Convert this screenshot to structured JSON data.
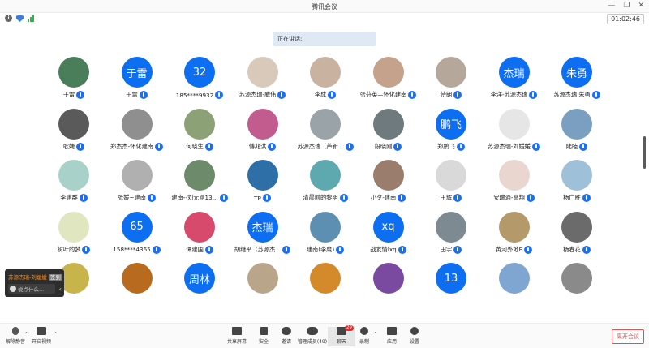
{
  "window": {
    "title": "腾讯会议"
  },
  "status": {
    "timer": "01:02:46"
  },
  "banner": {
    "speaking": "正在讲话:"
  },
  "participants": [
    {
      "name": "于雷",
      "avatar_text": "",
      "color": "#4a7e5a"
    },
    {
      "name": "于雷",
      "avatar_text": "于雷",
      "color": "#0e6ef2"
    },
    {
      "name": "185****9932",
      "avatar_text": "32",
      "color": "#0e6ef2"
    },
    {
      "name": "苏源杰瑞-威伟",
      "avatar_text": "",
      "color": "#d9c9bb"
    },
    {
      "name": "李成",
      "avatar_text": "",
      "color": "#c9b3a0"
    },
    {
      "name": "张芬英—怀化建南",
      "avatar_text": "",
      "color": "#c5a28c"
    },
    {
      "name": "侍朗",
      "avatar_text": "",
      "color": "#b5a79a"
    },
    {
      "name": "李洋-苏源杰瑞",
      "avatar_text": "杰瑞",
      "color": "#0e6ef2"
    },
    {
      "name": "苏源杰瑞 朱勇",
      "avatar_text": "朱勇",
      "color": "#0e6ef2"
    },
    {
      "name": "耿婕",
      "avatar_text": "",
      "color": "#5a5a5a"
    },
    {
      "name": "郑杰杰-怀化建南",
      "avatar_text": "",
      "color": "#8f8f8f"
    },
    {
      "name": "何晓生",
      "avatar_text": "",
      "color": "#8da177"
    },
    {
      "name": "傅兆洪",
      "avatar_text": "",
      "color": "#c25b8e"
    },
    {
      "name": "苏源杰瑞（芦新...",
      "avatar_text": "",
      "color": "#9aa3a8"
    },
    {
      "name": "段晓刚",
      "avatar_text": "",
      "color": "#6f7a7f"
    },
    {
      "name": "郑鹏飞",
      "avatar_text": "鹏飞",
      "color": "#0e6ef2"
    },
    {
      "name": "苏源杰瑞-刘媛媛",
      "avatar_text": "",
      "color": "#e6e6e6"
    },
    {
      "name": "陆睦",
      "avatar_text": "",
      "color": "#7a9fc1"
    },
    {
      "name": "李建群",
      "avatar_text": "",
      "color": "#a7d1c9"
    },
    {
      "name": "张媛~建南",
      "avatar_text": "",
      "color": "#b0b0b0"
    },
    {
      "name": "建南--刘元刚13...",
      "avatar_text": "",
      "color": "#6d8a6a"
    },
    {
      "name": "TP",
      "avatar_text": "",
      "color": "#2f6fa8"
    },
    {
      "name": "清晨前的黎明",
      "avatar_text": "",
      "color": "#5ea9b0"
    },
    {
      "name": "小夕-建南",
      "avatar_text": "",
      "color": "#9a7d6c"
    },
    {
      "name": "王辉",
      "avatar_text": "",
      "color": "#d9d9d9"
    },
    {
      "name": "安瑞通-高翔",
      "avatar_text": "",
      "color": "#e9d6cf"
    },
    {
      "name": "杨广胜",
      "avatar_text": "",
      "color": "#9fc0d9"
    },
    {
      "name": "树叶的梦",
      "avatar_text": "",
      "color": "#e0e6c0"
    },
    {
      "name": "158****4365",
      "avatar_text": "65",
      "color": "#0e6ef2"
    },
    {
      "name": "谭建国",
      "avatar_text": "",
      "color": "#d84a6b"
    },
    {
      "name": "胡继平（苏源杰...",
      "avatar_text": "杰瑞",
      "color": "#0e6ef2"
    },
    {
      "name": "建南(李鹰)",
      "avatar_text": "",
      "color": "#5d8fb2"
    },
    {
      "name": "战友情lxq",
      "avatar_text": "xq",
      "color": "#0e6ef2"
    },
    {
      "name": "田宇",
      "avatar_text": "",
      "color": "#7d8a92"
    },
    {
      "name": "黄河外地E",
      "avatar_text": "",
      "color": "#b49a6a"
    },
    {
      "name": "杨春花",
      "avatar_text": "",
      "color": "#6b6b6b"
    },
    {
      "name": "",
      "avatar_text": "",
      "color": "#c7b44a"
    },
    {
      "name": "",
      "avatar_text": "",
      "color": "#b86b1f"
    },
    {
      "name": "",
      "avatar_text": "周林",
      "color": "#0e6ef2"
    },
    {
      "name": "",
      "avatar_text": "",
      "color": "#b9a58a"
    },
    {
      "name": "",
      "avatar_text": "",
      "color": "#d48a2a"
    },
    {
      "name": "",
      "avatar_text": "",
      "color": "#7a4aa0"
    },
    {
      "name": "",
      "avatar_text": "13",
      "color": "#0e6ef2"
    },
    {
      "name": "",
      "avatar_text": "",
      "color": "#7fa6d1"
    },
    {
      "name": "",
      "avatar_text": "",
      "color": "#8a8a8a"
    }
  ],
  "chat": {
    "sender": "苏源杰瑞-刘媛媛",
    "tag": "签到",
    "placeholder": "说点什么..."
  },
  "toolbar": {
    "unmute": "解除静音",
    "start_video": "开启视频",
    "share_screen": "共享屏幕",
    "security": "安全",
    "invite": "邀请",
    "manage_members": "管理成员(49)",
    "chat": "聊天",
    "chat_badge": "29",
    "record": "录制",
    "apps": "应用",
    "settings": "设置",
    "leave": "离开会议"
  }
}
